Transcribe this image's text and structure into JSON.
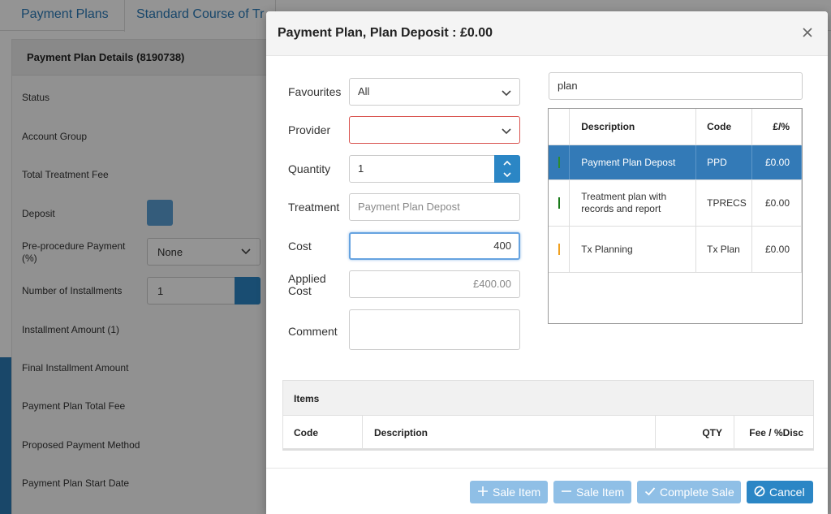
{
  "background": {
    "tabs": [
      "Payment Plans",
      "Standard Course of Tr"
    ],
    "panel_title": "Payment Plan Details (8190738)",
    "rows": [
      "Status",
      "Account Group",
      "Total Treatment Fee",
      "Deposit",
      "Pre-procedure Payment (%)",
      "Number of Installments",
      "Installment Amount (1)",
      "Final Installment Amount",
      "Payment Plan Total Fee",
      "Proposed Payment Method",
      "Payment Plan Start Date"
    ],
    "preprocedure_value": "None",
    "installments_value": "1"
  },
  "modal": {
    "title": "Payment Plan, Plan Deposit : £0.00",
    "form": {
      "favourites_label": "Favourites",
      "favourites_value": "All",
      "provider_label": "Provider",
      "provider_value": "",
      "quantity_label": "Quantity",
      "quantity_value": "1",
      "treatment_label": "Treatment",
      "treatment_placeholder": "Payment Plan Depost",
      "cost_label": "Cost",
      "cost_value": "400",
      "applied_cost_label": "Applied Cost",
      "applied_cost_value": "£400.00",
      "comment_label": "Comment",
      "comment_value": ""
    },
    "search": {
      "value": "plan"
    },
    "results": {
      "headers": [
        "Description",
        "Code",
        "£/%"
      ],
      "rows": [
        {
          "description": "Payment Plan Depost",
          "code": "PPD",
          "price": "£0.00",
          "indicator_color": "#2e8b2e",
          "selected": true
        },
        {
          "description": "Treatment plan with records and report",
          "code": "TPRECS",
          "price": "£0.00",
          "indicator_color": "#1a7a1a",
          "selected": false
        },
        {
          "description": "Tx Planning",
          "code": "Tx Plan",
          "price": "£0.00",
          "indicator_color": "#f0a020",
          "selected": false
        }
      ]
    },
    "items": {
      "title": "Items",
      "columns": [
        "Code",
        "Description",
        "QTY",
        "Fee / %Disc"
      ]
    },
    "footer": {
      "add_sale_item": "Sale Item",
      "remove_sale_item": "Sale Item",
      "complete_sale": "Complete Sale",
      "cancel": "Cancel"
    }
  },
  "colors": {
    "primary": "#2b86c5",
    "selected_row": "#337ab7",
    "disabled_button": "#8fbfe6",
    "invalid_border": "#d9534f"
  }
}
